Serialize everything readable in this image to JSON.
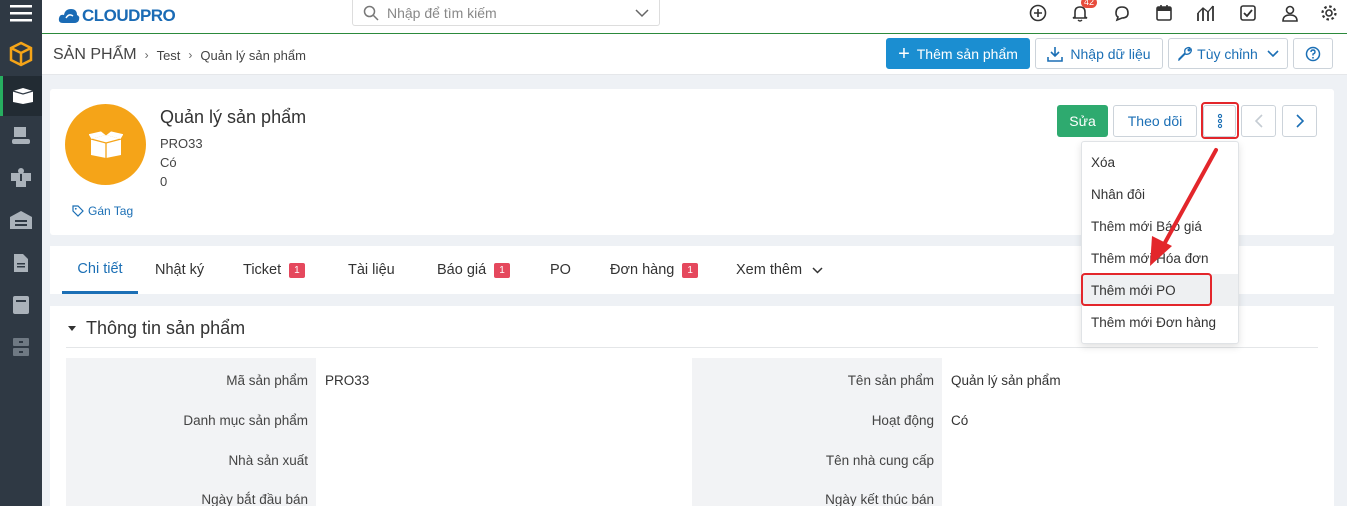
{
  "app": {
    "brand": "CLOUDPRO",
    "accent": "#1b8ed1",
    "success": "#2eaa6f",
    "highlight_red": "#e3262b"
  },
  "topbar": {
    "search_placeholder": "Nhập để tìm kiếm",
    "notification_count": "42",
    "icons": [
      "plus-circle-icon",
      "bell-icon",
      "chat-icon",
      "calendar-icon",
      "chart-icon",
      "checkbox-icon",
      "user-icon",
      "gear-icon"
    ]
  },
  "sidebar": {
    "icons": [
      "menu-icon",
      "products-cube-icon",
      "box-icon",
      "hand-box-icon",
      "boxes-icon",
      "warehouse-icon",
      "document-icon",
      "book-icon",
      "archive-icon"
    ]
  },
  "breadcrumb": {
    "module": "SẢN PHẨM",
    "level1": "Test",
    "level2": "Quản lý sản phẩm"
  },
  "header_actions": {
    "add": "Thêm sản phẩm",
    "import": "Nhập dữ liệu",
    "customize": "Tùy chỉnh"
  },
  "record": {
    "title": "Quản lý sản phẩm",
    "code": "PRO33",
    "active": "Có",
    "value": "0",
    "tag_label": "Gán Tag",
    "edit": "Sửa",
    "follow": "Theo dõi"
  },
  "menu": {
    "items": [
      "Xóa",
      "Nhân đôi",
      "Thêm mới Báo giá",
      "Thêm mới Hóa đơn",
      "Thêm mới PO",
      "Thêm mới Đơn hàng"
    ]
  },
  "tabs": {
    "chi_tiet": "Chi tiết",
    "nhat_ky": "Nhật ký",
    "ticket": "Ticket",
    "ticket_count": "1",
    "tai_lieu": "Tài liệu",
    "bao_gia": "Báo giá",
    "bao_gia_count": "1",
    "po": "PO",
    "don_hang": "Đơn hàng",
    "don_hang_count": "1",
    "xem_them": "Xem thêm"
  },
  "section": {
    "title": "Thông tin sản phẩm",
    "left": [
      {
        "label": "Mã sản phẩm",
        "value": "PRO33"
      },
      {
        "label": "Danh mục sản phẩm",
        "value": ""
      },
      {
        "label": "Nhà sản xuất",
        "value": ""
      },
      {
        "label": "Ngày bắt đầu bán",
        "value": ""
      }
    ],
    "right": [
      {
        "label": "Tên sản phẩm",
        "value": "Quản lý sản phẩm"
      },
      {
        "label": "Hoạt động",
        "value": "Có"
      },
      {
        "label": "Tên nhà cung cấp",
        "value": ""
      },
      {
        "label": "Ngày kết thúc bán",
        "value": ""
      }
    ]
  }
}
